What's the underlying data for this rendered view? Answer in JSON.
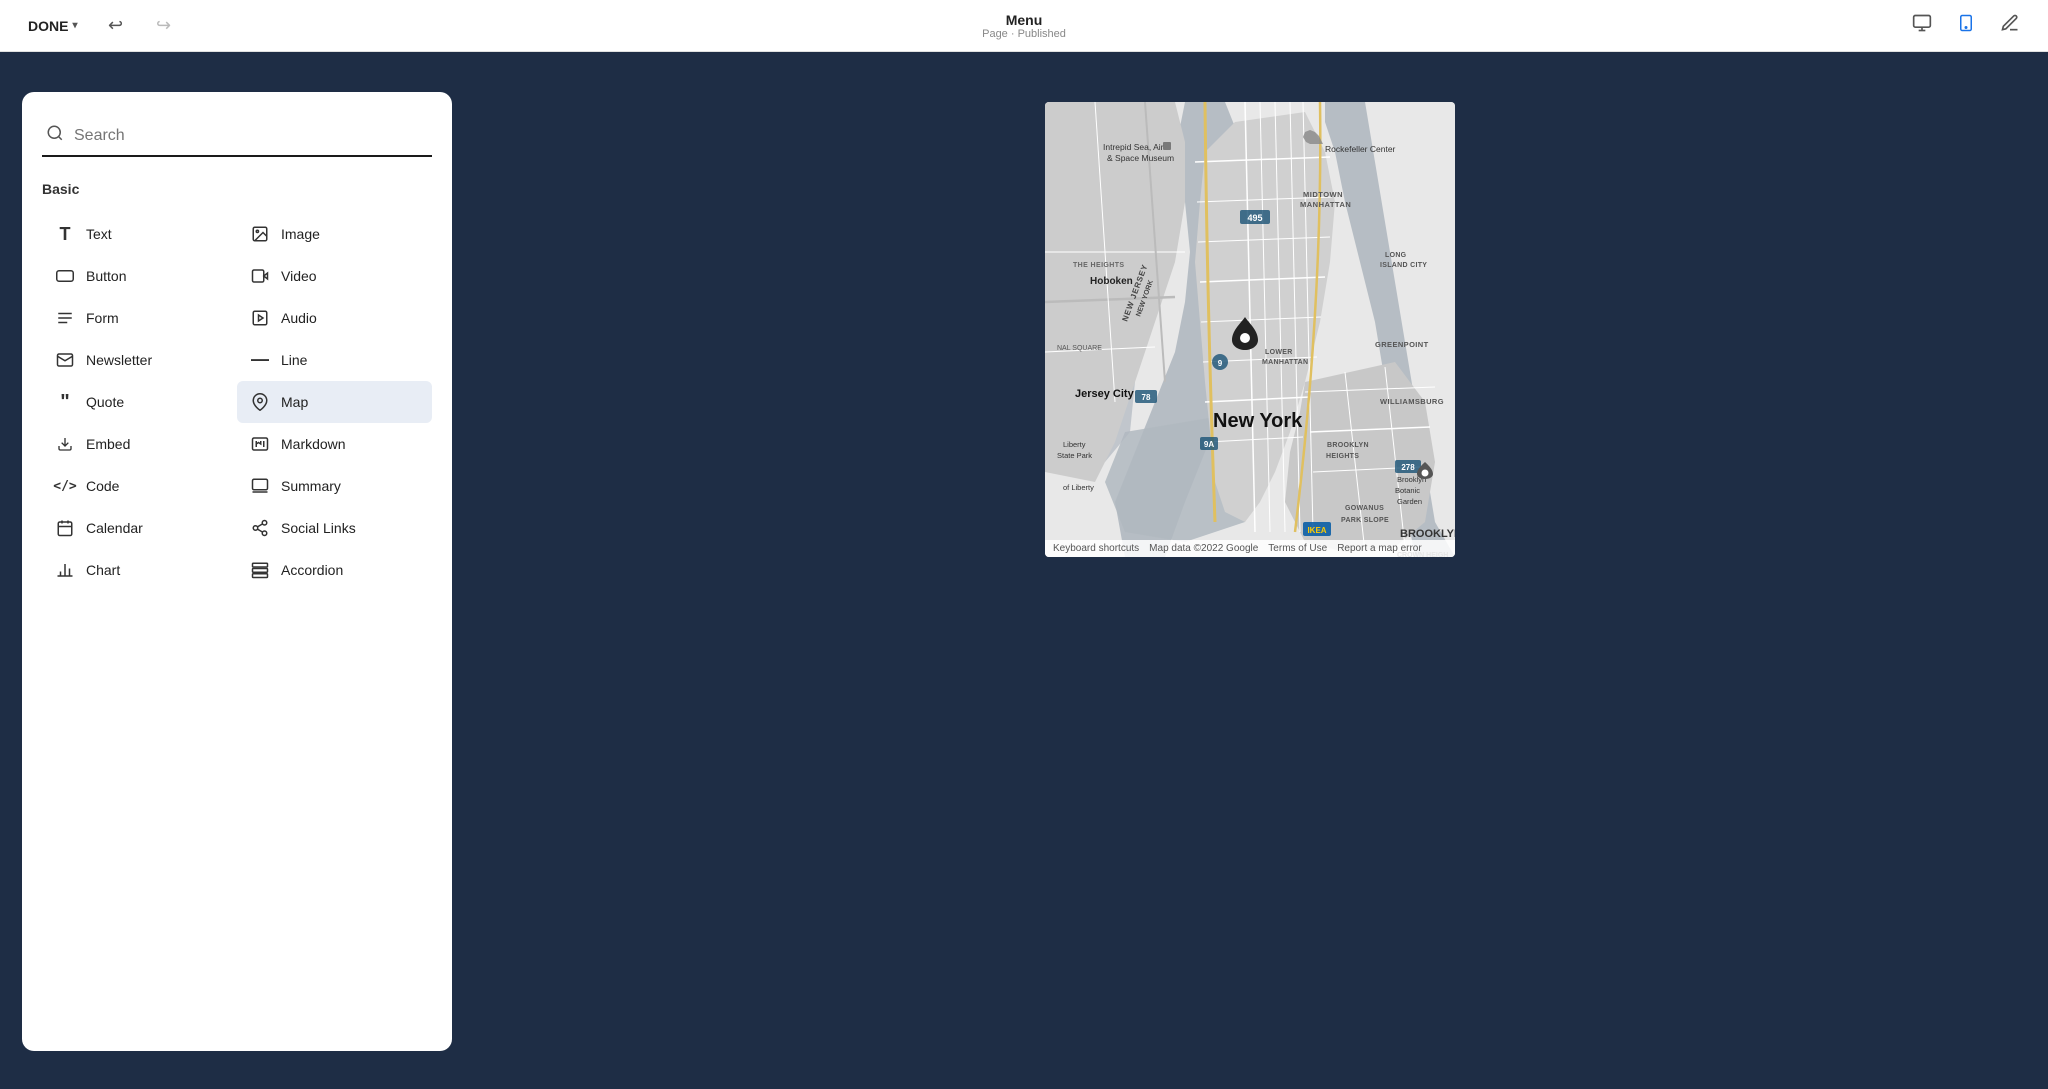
{
  "topbar": {
    "done_label": "DONE",
    "title": "Menu",
    "subtitle": "Page · Published",
    "desktop_icon": "🖥",
    "mobile_icon": "📱",
    "pencil_icon": "✏"
  },
  "sidebar": {
    "search_placeholder": "Search",
    "section_label": "Basic",
    "items": [
      {
        "id": "text",
        "label": "Text",
        "icon": "T",
        "col": 0
      },
      {
        "id": "image",
        "label": "Image",
        "icon": "IMG",
        "col": 1
      },
      {
        "id": "button",
        "label": "Button",
        "icon": "BTN",
        "col": 0
      },
      {
        "id": "video",
        "label": "Video",
        "icon": "▶",
        "col": 1
      },
      {
        "id": "form",
        "label": "Form",
        "icon": "≡",
        "col": 0
      },
      {
        "id": "audio",
        "label": "Audio",
        "icon": "♪",
        "col": 1
      },
      {
        "id": "newsletter",
        "label": "Newsletter",
        "icon": "✉",
        "col": 0
      },
      {
        "id": "line",
        "label": "Line",
        "icon": "—",
        "col": 1
      },
      {
        "id": "quote",
        "label": "Quote",
        "icon": "❝",
        "col": 0
      },
      {
        "id": "map",
        "label": "Map",
        "icon": "📍",
        "col": 1,
        "active": true
      },
      {
        "id": "embed",
        "label": "Embed",
        "icon": "↓",
        "col": 0
      },
      {
        "id": "markdown",
        "label": "Markdown",
        "icon": "MD",
        "col": 1
      },
      {
        "id": "code",
        "label": "Code",
        "icon": "</>",
        "col": 0
      },
      {
        "id": "summary",
        "label": "Summary",
        "icon": "▦",
        "col": 1
      },
      {
        "id": "calendar",
        "label": "Calendar",
        "icon": "📅",
        "col": 0
      },
      {
        "id": "social-links",
        "label": "Social Links",
        "icon": "⚙",
        "col": 1
      },
      {
        "id": "chart",
        "label": "Chart",
        "icon": "📊",
        "col": 0
      },
      {
        "id": "accordion",
        "label": "Accordion",
        "icon": "≡",
        "col": 1
      }
    ]
  },
  "map": {
    "city": "New York",
    "credit_keyboard": "Keyboard shortcuts",
    "credit_data": "Map data ©2022 Google",
    "credit_terms": "Terms of Use",
    "credit_error": "Report a map error"
  }
}
